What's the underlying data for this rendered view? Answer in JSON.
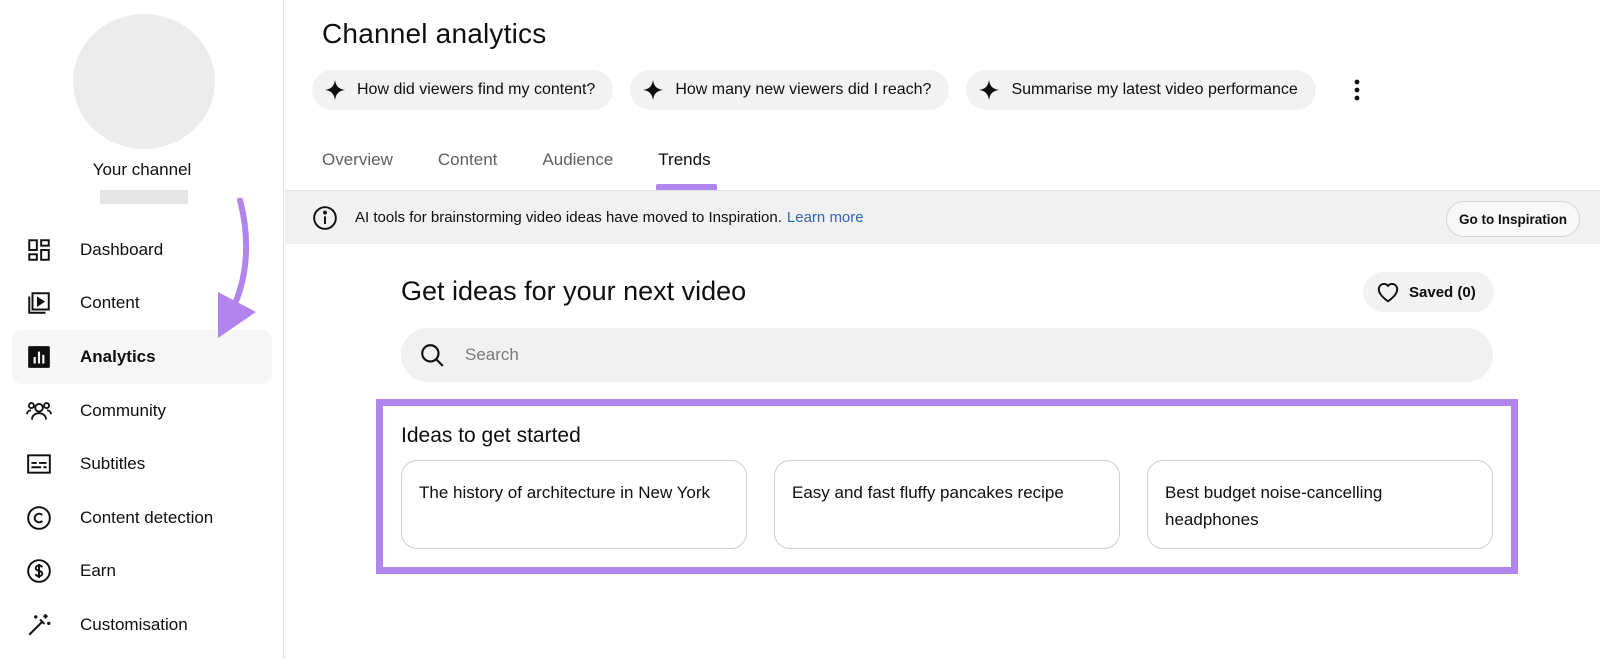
{
  "sidebar": {
    "channel_name": "Your channel",
    "items": [
      {
        "label": "Dashboard",
        "icon": "dashboard-icon",
        "active": false
      },
      {
        "label": "Content",
        "icon": "content-icon",
        "active": false
      },
      {
        "label": "Analytics",
        "icon": "analytics-icon",
        "active": true
      },
      {
        "label": "Community",
        "icon": "community-icon",
        "active": false
      },
      {
        "label": "Subtitles",
        "icon": "subtitles-icon",
        "active": false
      },
      {
        "label": "Content detection",
        "icon": "copyright-icon",
        "active": false
      },
      {
        "label": "Earn",
        "icon": "dollar-icon",
        "active": false
      },
      {
        "label": "Customisation",
        "icon": "magic-wand-icon",
        "active": false
      }
    ]
  },
  "header": {
    "title": "Channel analytics",
    "chips": [
      "How did viewers find my content?",
      "How many new viewers did I reach?",
      "Summarise my latest video performance"
    ]
  },
  "tabs": [
    {
      "label": "Overview",
      "active": false
    },
    {
      "label": "Content",
      "active": false
    },
    {
      "label": "Audience",
      "active": false
    },
    {
      "label": "Trends",
      "active": true
    }
  ],
  "banner": {
    "text": "AI tools for brainstorming video ideas have moved to Inspiration.",
    "link": "Learn more",
    "button": "Go to Inspiration"
  },
  "ideas": {
    "heading": "Get ideas for your next video",
    "saved_label": "Saved (0)",
    "search_placeholder": "Search",
    "started_title": "Ideas to get started",
    "cards": [
      "The history of architecture in New York",
      "Easy and fast fluffy pancakes recipe",
      "Best budget noise-cancelling headphones"
    ]
  },
  "colors": {
    "accent": "#b284ee",
    "link": "#3565a9"
  }
}
